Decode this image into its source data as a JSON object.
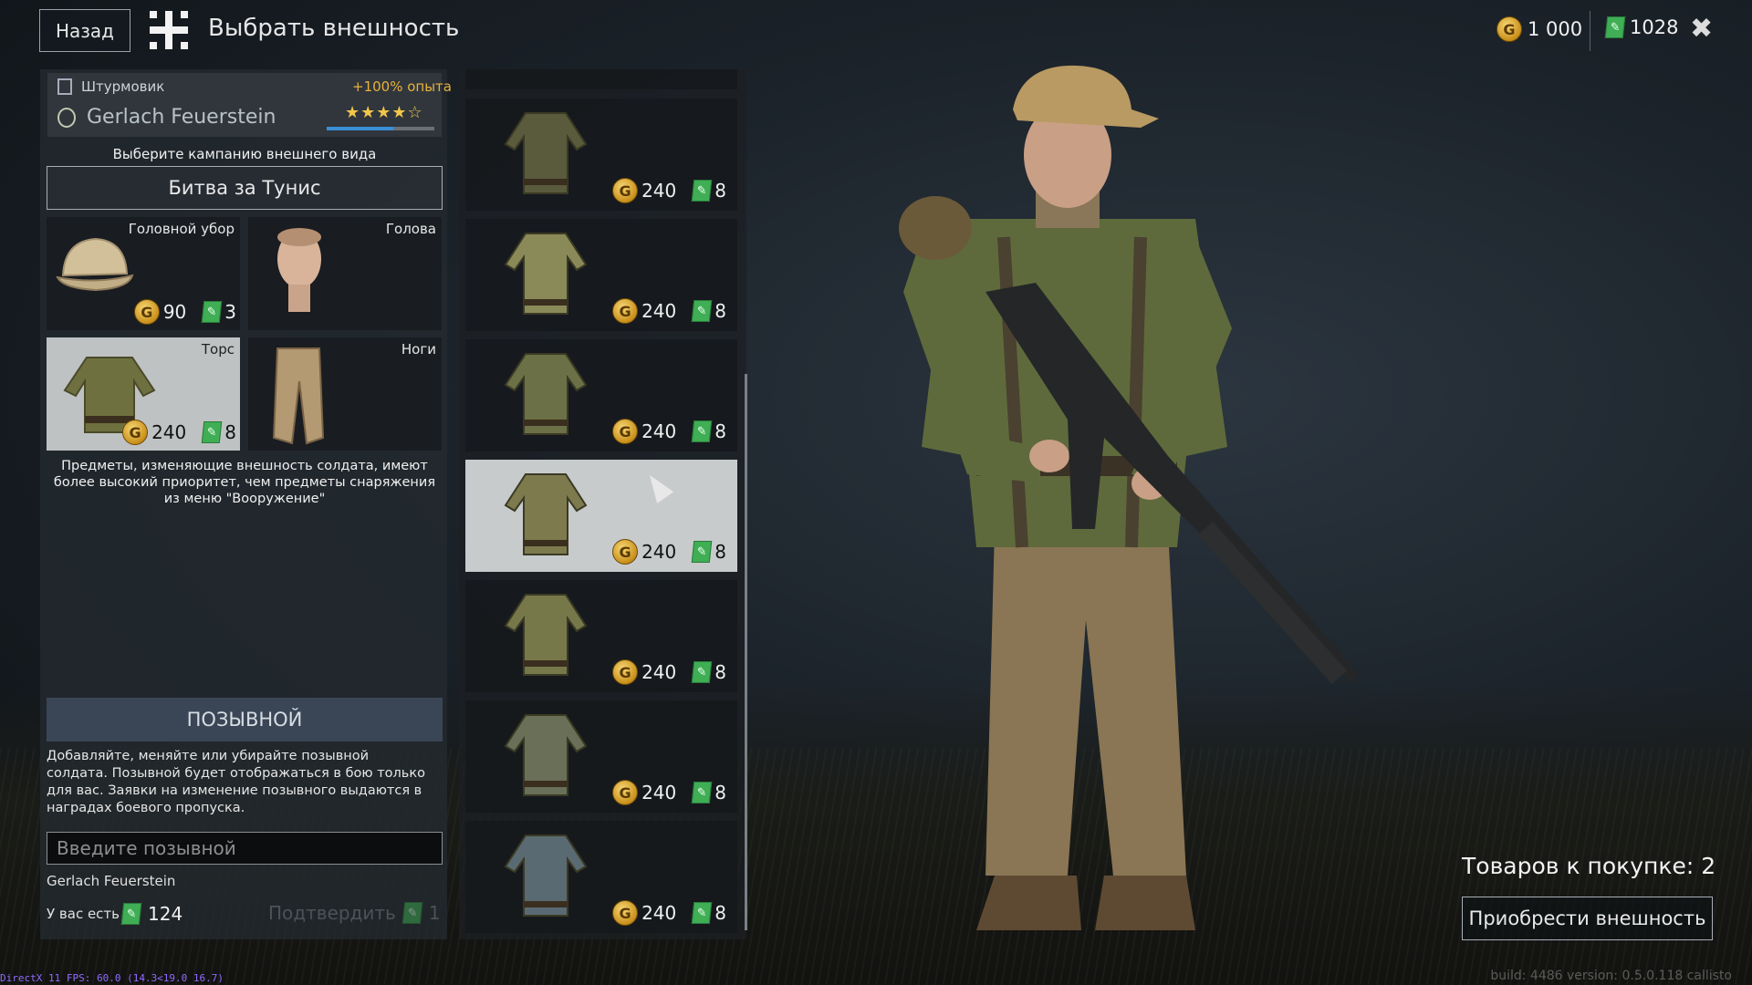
{
  "header": {
    "back_label": "Назад",
    "title": "Выбрать внешность",
    "silver": "1 000",
    "tickets": "1028"
  },
  "soldier": {
    "class": "Штурмовик",
    "xp_bonus": "+100% опыта",
    "name": "Gerlach Feuerstein",
    "stars": "★★★★☆",
    "rank_progress": 0.62
  },
  "campaign": {
    "hint": "Выберите кампанию внешнего вида",
    "selected": "Битва за Тунис"
  },
  "slots": [
    {
      "label": "Головной убор",
      "price": "90",
      "tickets": "3",
      "icon": "field-cap-icon"
    },
    {
      "label": "Голова",
      "price": "",
      "tickets": "",
      "icon": "head-icon"
    },
    {
      "label": "Торс",
      "price": "240",
      "tickets": "8",
      "icon": "tunic-icon"
    },
    {
      "label": "Ноги",
      "price": "",
      "tickets": "",
      "icon": "trousers-icon"
    }
  ],
  "note": "Предметы, изменяющие внешность солдата, имеют более высокий приоритет, чем предметы снаряжения из меню \"Вооружение\"",
  "callsign": {
    "header": "ПОЗЫВНОЙ",
    "description": "Добавляйте, меняйте или убирайте позывной солдата. Позывной будет отображаться в бою только для вас. Заявки на изменение позывного выдаются в наградах боевого пропуска.",
    "placeholder": "Введите позывной",
    "current": "Gerlach Feuerstein",
    "have_label": "У вас есть",
    "have_value": "124",
    "confirm_label": "Подтвердить",
    "confirm_cost": "1"
  },
  "torso_list": [
    {
      "price": "240",
      "tickets": "8",
      "color": "#5a5a3c"
    },
    {
      "price": "240",
      "tickets": "8",
      "color": "#8a8a58"
    },
    {
      "price": "240",
      "tickets": "8",
      "color": "#6b7046"
    },
    {
      "price": "240",
      "tickets": "8",
      "color": "#7d7a4e"
    },
    {
      "price": "240",
      "tickets": "8",
      "color": "#77784a"
    },
    {
      "price": "240",
      "tickets": "8",
      "color": "#6a7058"
    },
    {
      "price": "240",
      "tickets": "8",
      "color": "#5a6a72"
    }
  ],
  "purchase": {
    "count_label": "Товаров к покупке: 2",
    "buy_label": "Приобрести внешность"
  },
  "footer": {
    "debug": "DirectX 11 FPS: 60.0 (14.3<19.0 16.7)",
    "build": "build: 4486 version: 0.5.0.118 callisto"
  }
}
